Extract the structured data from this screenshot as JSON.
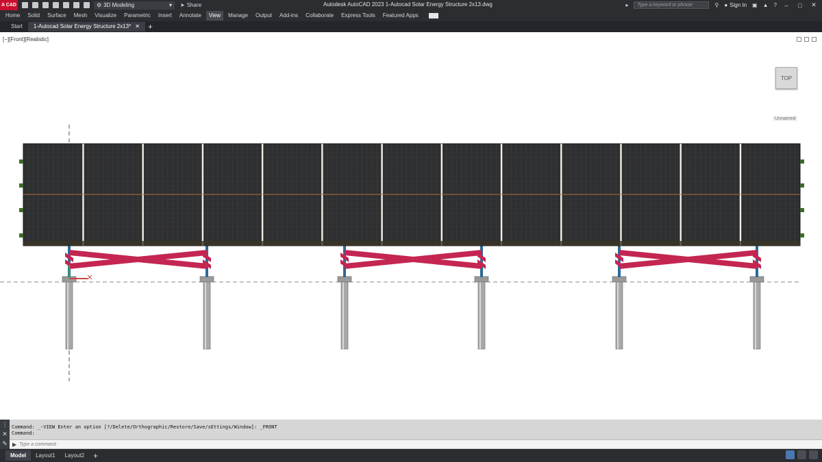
{
  "app": {
    "logo_text": "A CAD",
    "title": "Autodesk AutoCAD 2023    1-Autocad Solar Energy Structure 2x13.dwg",
    "workspace": "3D Modeling",
    "share_label": "Share",
    "search_placeholder": "Type a keyword or phrase",
    "signin_label": "Sign In"
  },
  "ribbon": {
    "tabs": [
      "Home",
      "Solid",
      "Surface",
      "Mesh",
      "Visualize",
      "Parametric",
      "Insert",
      "Annotate",
      "View",
      "Manage",
      "Output",
      "Add-ins",
      "Collaborate",
      "Express Tools",
      "Featured Apps"
    ],
    "active": "View"
  },
  "file_tabs": {
    "start": "Start",
    "active": "1-Autocad Solar Energy Structure 2x13*"
  },
  "viewport": {
    "label": "[−][Front][Realistic]",
    "viewcube_face": "TOP",
    "ucs_name": "Unnamed"
  },
  "command_line": {
    "history": [
      "Command: _-VIEW Enter an option [?/Delete/Orthographic/Restore/Save/sEttings/Window]: _FRONT",
      "Command:"
    ],
    "placeholder": "Type a command"
  },
  "layout_tabs": {
    "items": [
      "Model",
      "Layout1",
      "Layout2"
    ],
    "active": "Model"
  },
  "colors": {
    "panel": "#2e2f31",
    "brace": "#c42651",
    "post": "#a9a9a9",
    "column": "#2a6a99",
    "chrome_dark": "#2b2d31"
  }
}
